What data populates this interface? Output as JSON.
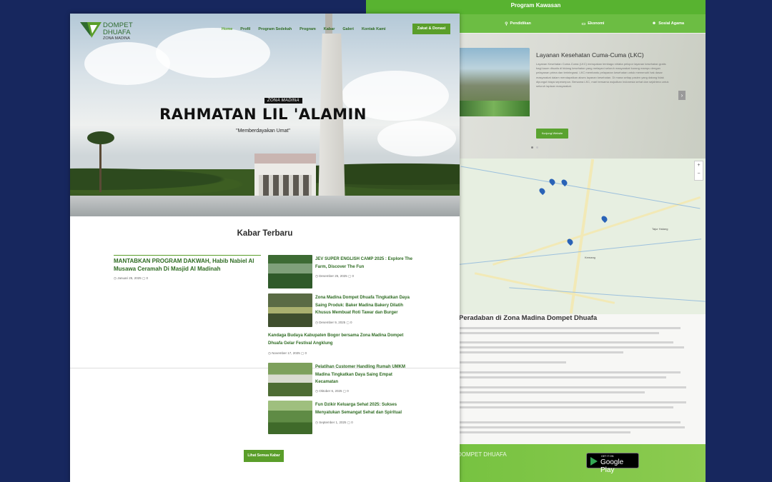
{
  "back": {
    "section_title": "Program Kawasan",
    "tabs": [
      {
        "icon": "pin-icon",
        "label": "Pendidikan"
      },
      {
        "icon": "money-icon",
        "label": "Ekonomi"
      },
      {
        "icon": "people-icon",
        "label": "Sosial Agama"
      }
    ],
    "program_title": "Layanan Kesehatan Cuma-Cuma (LKC)",
    "program_text": "Layanan Kesehatan Cuma-Cuma (LKC) merupakan lembaga nirlaba pelopor layanan kesehatan gratis bagi kaum dhuafa di bidang kesehatan yang melayani seluruh masyarakat kurang mampu dengan pelayanan prima dan terintegrasi. LKC membantu pelayanan kesehatan untuk memenuhi hak dasar masyarakat dalam mendapatkan akses layanan kesehatan. Di mana setiap pasien yang datang tidak dipungut biaya sepeserpun. Bersama LKC, mari bersama wujudkan Indonesia sehat dan sejahtera untuk seluruh lapisan masyarakat.",
    "program_button": "Kunjungi Website",
    "map_labels": [
      "Tajur Halang",
      "Kemang"
    ],
    "body_heading": "Peradaban di Zona Madina Dompet Dhuafa",
    "store_small": "GET IT ON",
    "store_large": "Google Play",
    "footer_logo": "DOMPET DHUAFA"
  },
  "front": {
    "logo": {
      "line1": "DOMPET",
      "line2": "DHUAFA",
      "line3": "ZONA MADINA"
    },
    "nav": [
      "Home",
      "Profil",
      "Program Sedekah",
      "Program",
      "Kabar",
      "Galeri",
      "Kontak Kami"
    ],
    "donate": "Zakat & Donasi",
    "hero": {
      "tag": "ZONA MADINA",
      "title": "RAHMATAN LIL 'ALAMIN",
      "subtitle": "\"Memberdayakan Umat\""
    },
    "news": {
      "heading": "Kabar Terbaru",
      "lead": {
        "title": "MANTABKAN PROGRAM DAKWAH, Habib Nabiel Al Musawa Ceramah Di Masjid Al Madinah",
        "date": "Januari 25, 2025",
        "comments": "0"
      },
      "items": [
        {
          "title": "JEV SUPER ENGLISH CAMP 2025 : Explore The Farm, Discover The Fun",
          "date": "Desember 25, 2025",
          "comments": "0"
        },
        {
          "title": "Zona Madina Dompet Dhuafa Tingkatkan Daya Saing Produk: Baker Madina Bakery Dilatih Khusus Membuat Roti Tawar dan Burger",
          "date": "Desember 9, 2025",
          "comments": "0"
        },
        {
          "title": "Kandaga Budaya Kabupaten Bogor bersama Zona Madina Dompet Dhuafa Gelar Festival Angklung",
          "date": "November 17, 2025",
          "comments": "0"
        },
        {
          "title": "Pelatihan Customer Handling Rumah UMKM Madina Tingkatkan Daya Saing Empat Kecamatan",
          "date": "Oktober 6, 2025",
          "comments": "0"
        },
        {
          "title": "Fun Dzikir Keluarga Sehat 2025: Sukses Menyatukan Semangat Sehat dan Spiritual",
          "date": "September 1, 2025",
          "comments": "0"
        }
      ],
      "more_button": "Lihat Semua Kabar"
    }
  },
  "colors": {
    "background": "#17275e",
    "primary_green": "#5a9e2a",
    "bar_green": "#58b330"
  }
}
